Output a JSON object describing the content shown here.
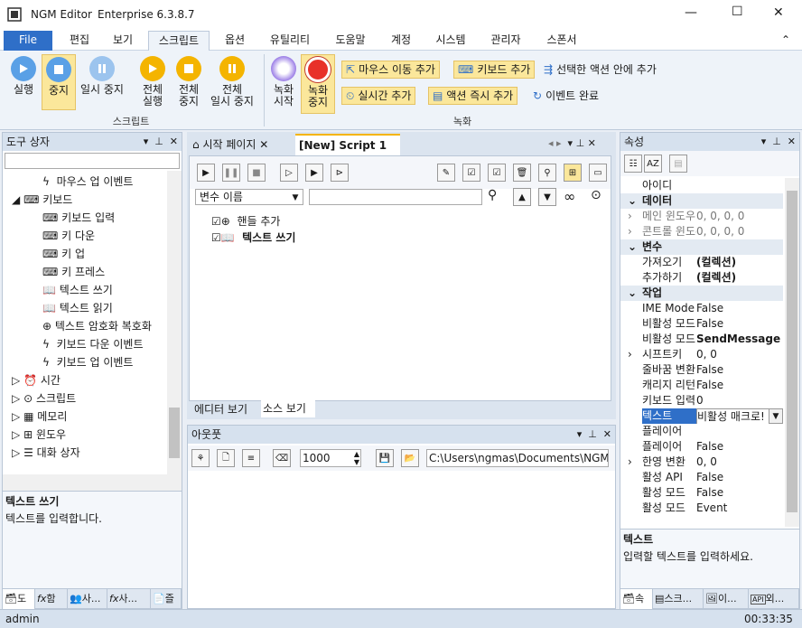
{
  "window": {
    "app_name": "NGM Editor",
    "edition": "Enterprise 6.3.8.7",
    "min": "—",
    "max": "☐",
    "close": "✕"
  },
  "menu": {
    "file": "File",
    "tabs": [
      "편집",
      "보기",
      "스크립트",
      "옵션",
      "유틸리티",
      "도움말",
      "계정",
      "시스템",
      "관리자",
      "스폰서"
    ],
    "collapse": "⌃"
  },
  "ribbon": {
    "script_group": "스크립트",
    "record_group": "녹화",
    "play": "실행",
    "stop": "중지",
    "pause": "일시 중지",
    "all_play": [
      "전체",
      "실행"
    ],
    "all_stop": [
      "전체",
      "중지"
    ],
    "all_pause": [
      "전체",
      "일시 중지"
    ],
    "rec_start": [
      "녹화",
      "시작"
    ],
    "rec_stop": [
      "녹화",
      "중지"
    ],
    "add_mouse_move": "마우스 이동 추가",
    "add_keyboard": "키보드 추가",
    "add_in_selected": "선택한 액션 안에 추가",
    "add_realtime": "실시간 추가",
    "add_action_now": "액션 즉시 추가",
    "event_done": "이벤트 완료"
  },
  "toolbox": {
    "title": "도구 상자",
    "search_value": "",
    "items": [
      {
        "label": "마우스 업 이벤트"
      },
      {
        "label": "키보드"
      },
      {
        "label": "키보드 입력"
      },
      {
        "label": "키 다운"
      },
      {
        "label": "키 업"
      },
      {
        "label": "키 프레스"
      },
      {
        "label": "텍스트 쓰기"
      },
      {
        "label": "텍스트 읽기"
      },
      {
        "label": "텍스트 암호화 복호화"
      },
      {
        "label": "키보드 다운 이벤트"
      },
      {
        "label": "키보드 업 이벤트"
      },
      {
        "label": "시간"
      },
      {
        "label": "스크립트"
      },
      {
        "label": "메모리"
      },
      {
        "label": "윈도우"
      },
      {
        "label": "대화 상자"
      }
    ],
    "desc_title": "텍스트 쓰기",
    "desc_text": "텍스트를 입력합니다.",
    "bottom_tabs": [
      "도",
      "함",
      "사...",
      "사...",
      "즐"
    ]
  },
  "editor": {
    "tab_start": "시작 페이지",
    "tab_script": "[New] Script 1",
    "var_select": "변수 이름",
    "search_value": "",
    "actions": [
      {
        "label": "핸들 추가",
        "bold": false
      },
      {
        "label": "텍스트 쓰기",
        "bold": true
      }
    ],
    "view_editor": "에디터 보기",
    "view_source": "소스 보기"
  },
  "output": {
    "title": "아웃풋",
    "count": "1000",
    "path": "C:\\Users\\ngmas\\Documents\\NGM6\\"
  },
  "properties": {
    "title": "속성",
    "rows": [
      {
        "type": "row",
        "name": "아이디",
        "value": "",
        "exp": ""
      },
      {
        "type": "cat",
        "name": "데이터",
        "value": "",
        "exp": "⌄"
      },
      {
        "type": "row",
        "name": "메인 윈도우",
        "value": "0, 0, 0, 0",
        "exp": "›"
      },
      {
        "type": "row",
        "name": "콘트롤 윈도우",
        "value": "0, 0, 0, 0",
        "exp": "›"
      },
      {
        "type": "cat",
        "name": "변수",
        "value": "",
        "exp": "⌄"
      },
      {
        "type": "row",
        "name": "가져오기",
        "value": "(컬렉션)",
        "exp": "",
        "bold": true
      },
      {
        "type": "row",
        "name": "추가하기",
        "value": "(컬렉션)",
        "exp": "",
        "bold": true
      },
      {
        "type": "cat",
        "name": "작업",
        "value": "",
        "exp": "⌄"
      },
      {
        "type": "row",
        "name": "IME Mode",
        "value": "False",
        "exp": ""
      },
      {
        "type": "row",
        "name": "비활성 모드",
        "value": "False",
        "exp": ""
      },
      {
        "type": "row",
        "name": "비활성 모드",
        "value": "SendMessage",
        "exp": "",
        "bold": true
      },
      {
        "type": "row",
        "name": "시프트키",
        "value": "0, 0",
        "exp": "›"
      },
      {
        "type": "row",
        "name": "줄바꿈 변환",
        "value": "False",
        "exp": ""
      },
      {
        "type": "row",
        "name": "캐리지 리턴",
        "value": "False",
        "exp": ""
      },
      {
        "type": "row",
        "name": "키보드 입력",
        "value": "0",
        "exp": ""
      },
      {
        "type": "row",
        "name": "텍스트",
        "value": "비활성 매크로!",
        "exp": "",
        "selected": true
      },
      {
        "type": "row",
        "name": "플레이어",
        "value": "",
        "exp": ""
      },
      {
        "type": "row",
        "name": "플레이어",
        "value": "False",
        "exp": ""
      },
      {
        "type": "row",
        "name": "한영 변환",
        "value": "0, 0",
        "exp": "›"
      },
      {
        "type": "row",
        "name": "활성 API",
        "value": "False",
        "exp": ""
      },
      {
        "type": "row",
        "name": "활성 모드",
        "value": "False",
        "exp": ""
      },
      {
        "type": "row",
        "name": "활성 모드",
        "value": "Event",
        "exp": ""
      }
    ],
    "desc_title": "텍스트",
    "desc_text": "입력할 텍스트를 입력하세요.",
    "bottom_tabs": [
      "속",
      "스크...",
      "이...",
      "외..."
    ]
  },
  "status": {
    "user": "admin",
    "time": "00:33:35"
  },
  "colors": {
    "accent": "#2f6fc8",
    "selected_tab": "#fbe79b",
    "record_red": "#e8312a"
  }
}
